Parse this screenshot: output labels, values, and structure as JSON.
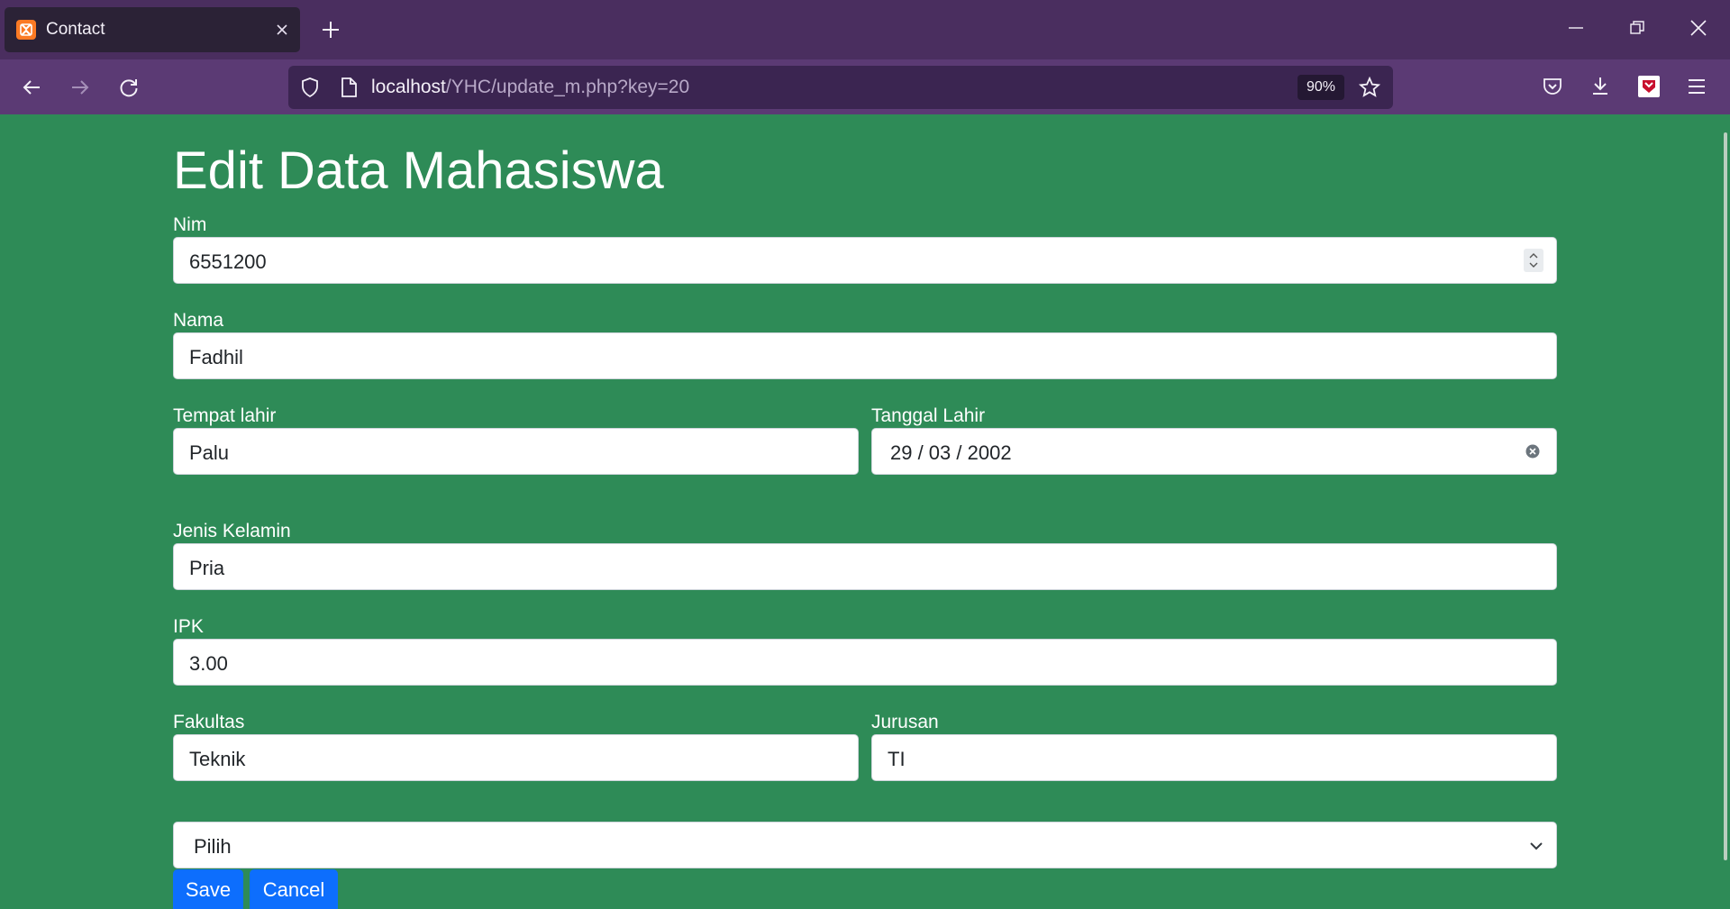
{
  "browser": {
    "tab_title": "Contact",
    "url_host": "localhost",
    "url_path": "/YHC/update_m.php?key=20",
    "zoom": "90%"
  },
  "page": {
    "heading": "Edit Data Mahasiswa",
    "fields": {
      "nim": {
        "label": "Nim",
        "value": "6551200"
      },
      "nama": {
        "label": "Nama",
        "value": "Fadhil"
      },
      "tempat_lahir": {
        "label": "Tempat lahir",
        "value": "Palu"
      },
      "tanggal_lahir": {
        "label": "Tanggal Lahir",
        "value": "29 / 03 / 2002"
      },
      "jenis_kelamin": {
        "label": "Jenis Kelamin",
        "value": "Pria"
      },
      "ipk": {
        "label": "IPK",
        "value": "3.00"
      },
      "fakultas": {
        "label": "Fakultas",
        "value": "Teknik"
      },
      "jurusan": {
        "label": "Jurusan",
        "value": "TI"
      }
    },
    "select": {
      "value": "Pilih"
    },
    "buttons": {
      "save": "Save",
      "cancel": "Cancel"
    }
  },
  "colors": {
    "page_background": "#2e8b57",
    "button_primary": "#0d6efd",
    "browser_frame": "#4a2e5f",
    "toolbar": "#5b3a74"
  },
  "icons": [
    "xampp-favicon",
    "close-icon",
    "plus-icon",
    "minimize-icon",
    "restore-icon",
    "window-close-icon",
    "back-icon",
    "forward-icon",
    "reload-icon",
    "shield-icon",
    "page-icon",
    "star-icon",
    "pocket-icon",
    "download-icon",
    "extension-icon",
    "menu-icon",
    "spinner-icon",
    "clear-icon",
    "chevron-down-icon"
  ]
}
